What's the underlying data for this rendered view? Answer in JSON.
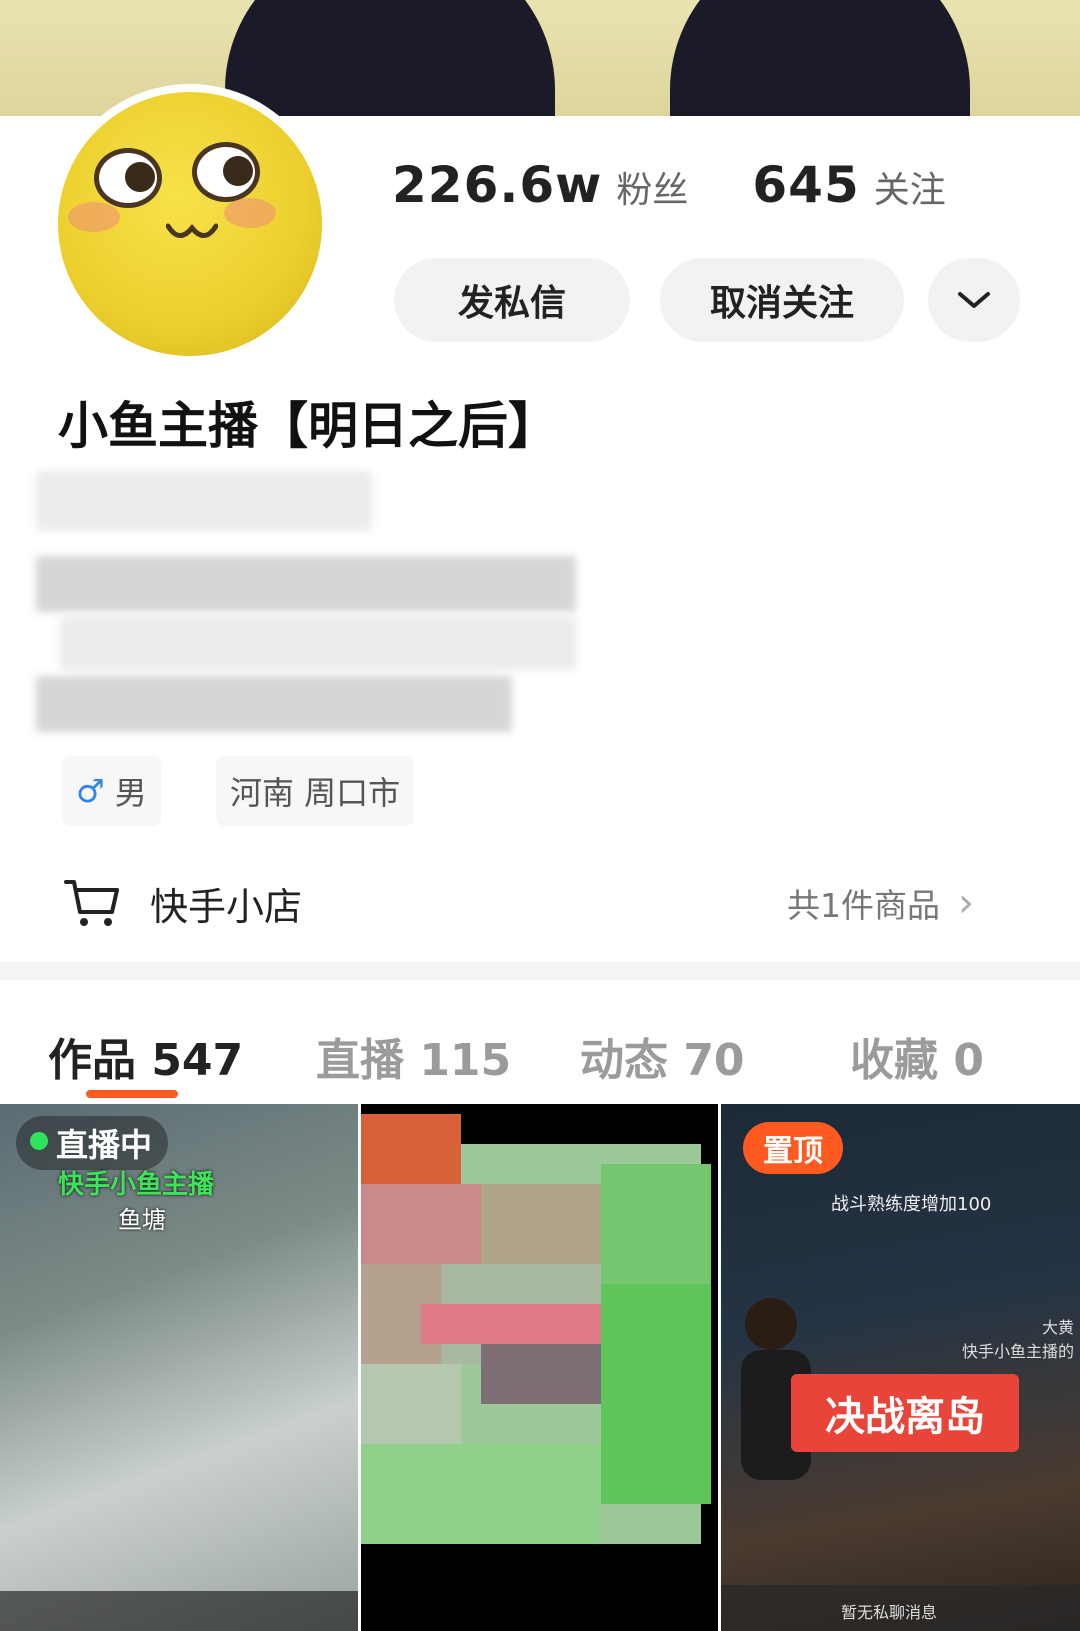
{
  "profile": {
    "followers_count": "226.6w",
    "followers_label": "粉丝",
    "following_count": "645",
    "following_label": "关注",
    "name": "小鱼主播【明日之后】",
    "gender_symbol": "♂",
    "gender": "男",
    "location": "河南 周口市"
  },
  "actions": {
    "message_label": "发私信",
    "unfollow_label": "取消关注",
    "more_icon": "chevron-down-icon"
  },
  "shop": {
    "title": "快手小店",
    "count": "共1件商品",
    "chevron": "›"
  },
  "tabs": [
    {
      "label": "作品 547"
    },
    {
      "label": "直播 115"
    },
    {
      "label": "动态 70"
    },
    {
      "label": "收藏 0"
    }
  ],
  "grid": {
    "item1": {
      "badge": "直播中",
      "channel": "快手小鱼主播",
      "sub": "鱼塘"
    },
    "item3": {
      "pin": "置顶",
      "title": "决战离岛",
      "note": "战斗熟练度增加100",
      "side_name": "大黄",
      "side_sub": "快手小鱼主播的",
      "chat": "暂无私聊消息"
    }
  },
  "colors": {
    "accent": "#ff5a1f",
    "live_green": "#2ee45a",
    "male_blue": "#2e86e6"
  }
}
